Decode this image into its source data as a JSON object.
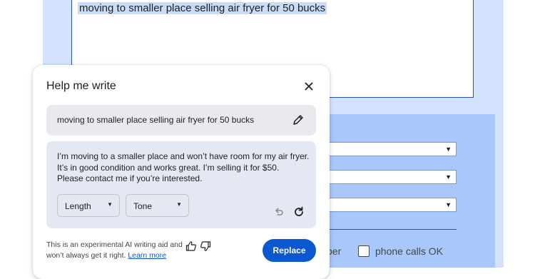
{
  "background_form": {
    "textarea_value": "moving to smaller place selling air fryer for 50 bucks",
    "partial_label": "ber",
    "phone_calls_label": "phone calls OK"
  },
  "dialog": {
    "title": "Help me write",
    "close_icon": "close-icon",
    "prompt": "moving to smaller place selling air fryer for 50 bucks",
    "result_lines": [
      "I’m moving to a smaller place and won’t have room for my air fryer.",
      "It’s in good condition and works great. I’m selling it for $50.",
      "Please contact me if you’re interested."
    ],
    "length_label": "Length",
    "tone_label": "Tone",
    "disclaimer_line1": "This is an experimental AI writing aid and",
    "disclaimer_line2": "won’t always get it right.",
    "learn_more": "Learn more",
    "replace_label": "Replace"
  },
  "colors": {
    "accent": "#0b57d0",
    "page_bg": "#d3e3fd",
    "form_panel": "#a8c7fa"
  }
}
